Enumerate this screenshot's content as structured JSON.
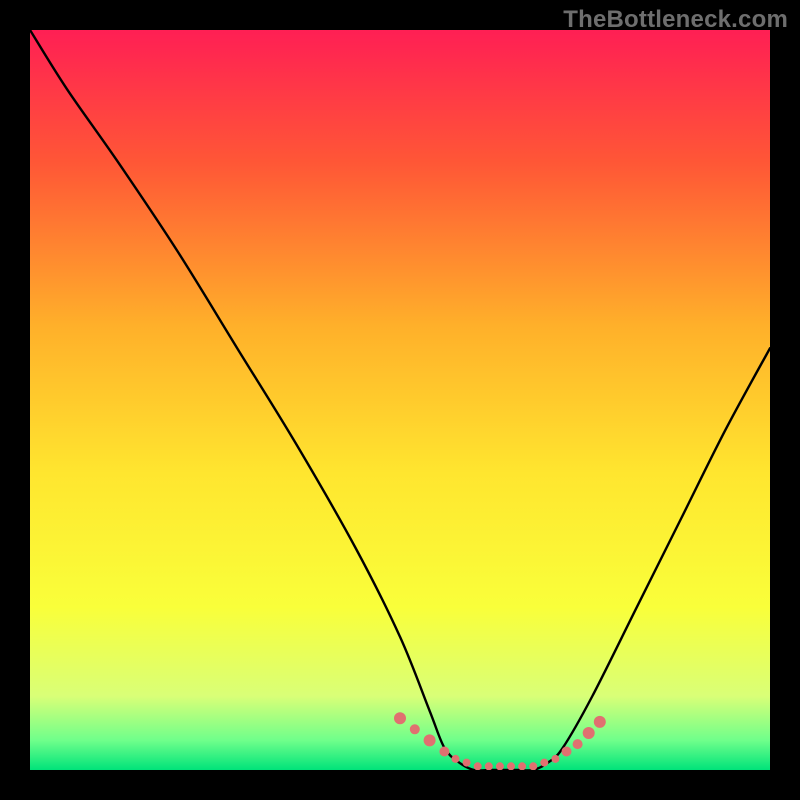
{
  "watermark": "TheBottleneck.com",
  "chart_data": {
    "type": "line",
    "title": "",
    "xlabel": "",
    "ylabel": "",
    "xlim": [
      0,
      100
    ],
    "ylim": [
      0,
      100
    ],
    "grid": false,
    "legend": false,
    "background_gradient": {
      "colors": [
        "#ff1f54",
        "#ff5736",
        "#ffb02a",
        "#ffe62f",
        "#f9ff3a",
        "#d9ff77",
        "#6fff8b",
        "#00e37a"
      ],
      "direction": "top-to-bottom"
    },
    "curve": {
      "description": "Bottleneck percentage curve (V-shape, minimum plateau near x=56–72)",
      "x": [
        0,
        5,
        12,
        20,
        28,
        36,
        44,
        50,
        54,
        56,
        58,
        60,
        62,
        64,
        66,
        68,
        70,
        72,
        76,
        82,
        88,
        94,
        100
      ],
      "y": [
        100,
        92,
        82,
        70,
        57,
        44,
        30,
        18,
        8,
        3,
        1,
        0,
        0,
        0,
        0,
        0,
        1,
        3,
        10,
        22,
        34,
        46,
        57
      ]
    },
    "markers": {
      "description": "Highlighted near-zero-bottleneck points",
      "color": "#e07070",
      "radius_sequence": [
        6,
        5,
        6,
        5,
        4,
        4,
        4,
        4,
        4,
        4,
        4,
        4,
        4,
        4,
        5,
        5,
        6,
        6
      ],
      "x": [
        50,
        52,
        54,
        56,
        57.5,
        59,
        60.5,
        62,
        63.5,
        65,
        66.5,
        68,
        69.5,
        71,
        72.5,
        74,
        75.5,
        77
      ],
      "y": [
        7,
        5.5,
        4,
        2.5,
        1.5,
        1,
        0.5,
        0.5,
        0.5,
        0.5,
        0.5,
        0.5,
        1,
        1.5,
        2.5,
        3.5,
        5,
        6.5
      ]
    }
  }
}
